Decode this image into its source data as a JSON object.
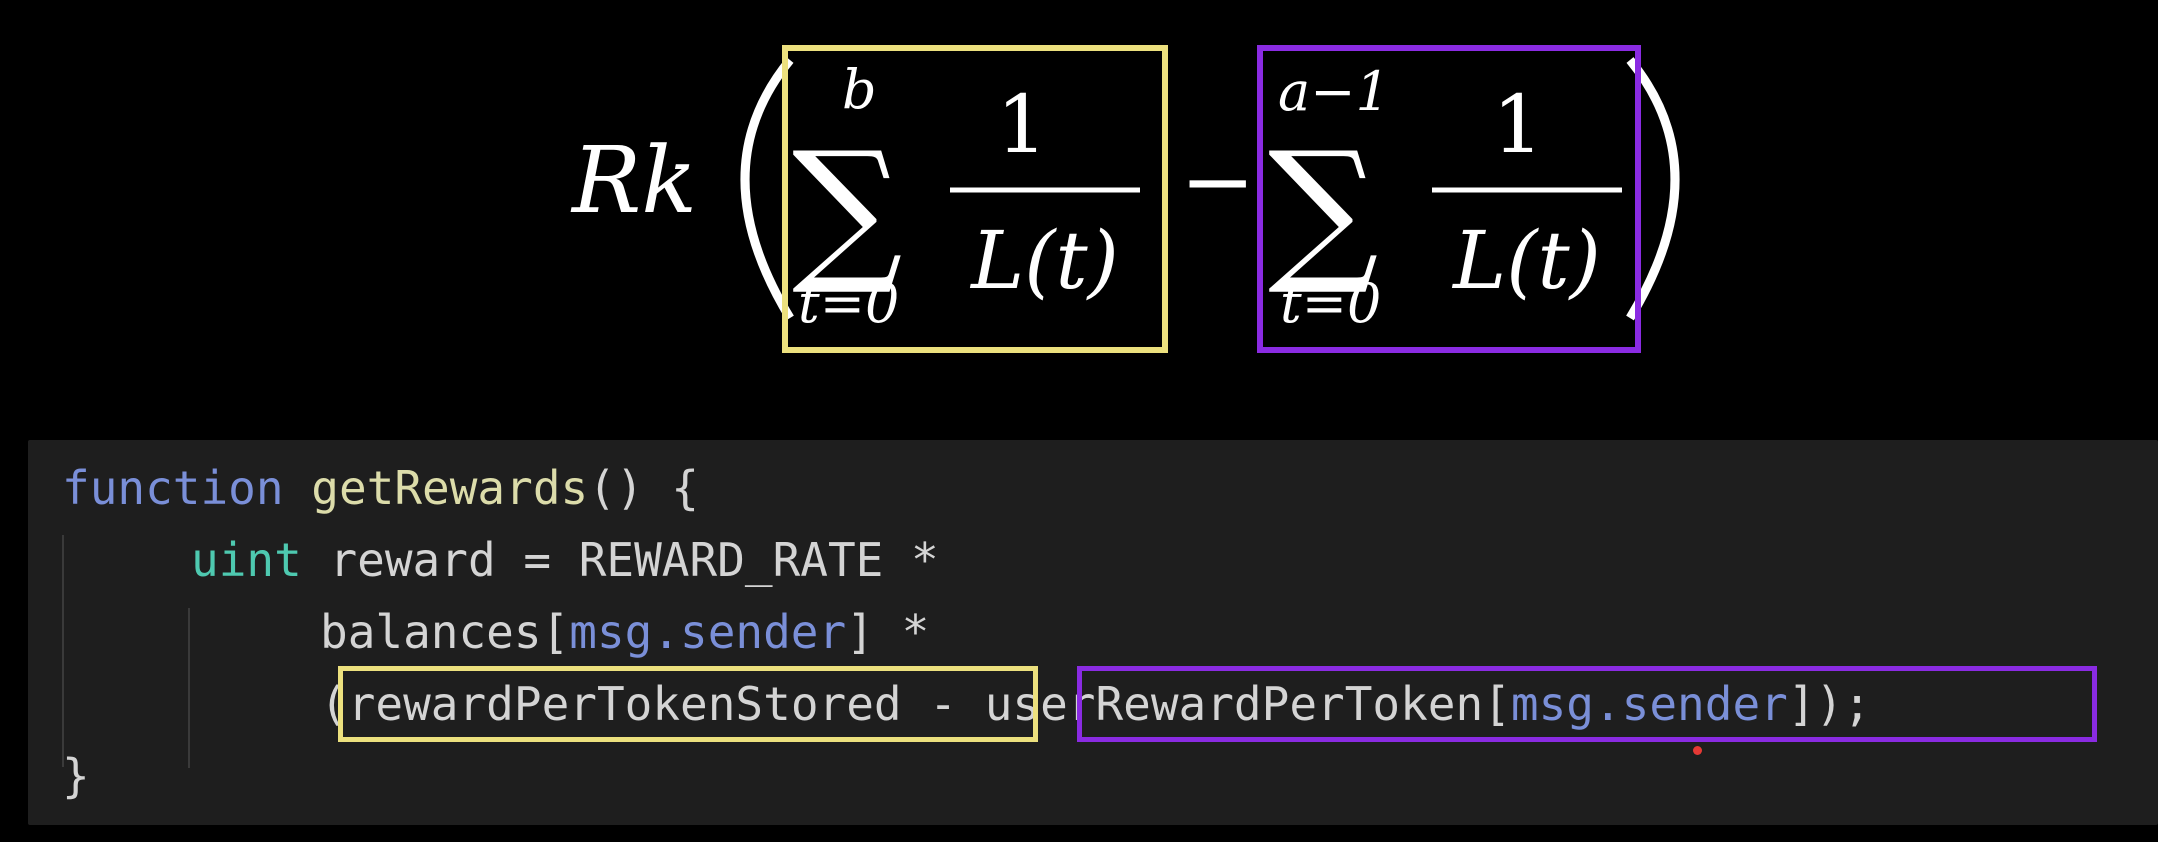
{
  "formula": {
    "coefficient": "Rk",
    "term1": {
      "upper": "b",
      "lower": "t=0",
      "numerator": "1",
      "denominator": "L(t)",
      "highlight_color": "#ece07e"
    },
    "operator": "−",
    "term2": {
      "upper": "a−1",
      "lower": "t=0",
      "numerator": "1",
      "denominator": "L(t)",
      "highlight_color": "#8a2be2"
    }
  },
  "code": {
    "line1": {
      "keyword": "function",
      "name": "getRewards",
      "rest": "() {"
    },
    "line2": {
      "type": "uint",
      "rest": " reward = REWARD_RATE *"
    },
    "line3": {
      "prefix": "balances[",
      "access": "msg.sender",
      "suffix": "] *"
    },
    "line4": {
      "open": "(",
      "stored": "rewardPerTokenStored",
      "minus": " - ",
      "user": "userRewardPerToken[",
      "access": "msg.sender",
      "close_bracket": "]",
      "end": ");"
    },
    "line5": "}"
  }
}
